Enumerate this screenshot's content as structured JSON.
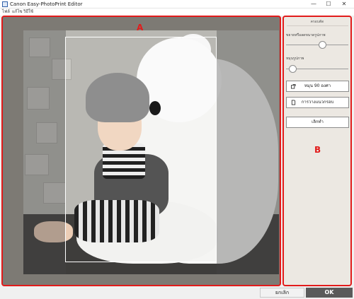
{
  "window": {
    "title": "Canon Easy-PhotoPrint Editor",
    "min_glyph": "—",
    "max_glyph": "☐",
    "close_glyph": "✕"
  },
  "menu": [
    "ไฟล์",
    "แก้ไข",
    "วิธีใช้"
  ],
  "panel_a": {
    "marker": "A"
  },
  "panel_b": {
    "marker": "B",
    "title": "ครอบตัด",
    "sliders": [
      {
        "label": "ขยายหรือลดขนาดรูปภาพ",
        "value": 0.6
      },
      {
        "label": "หมุนรูปภาพ",
        "value": 0.05
      }
    ],
    "buttons": {
      "rotate": "หมุน 90 องศา",
      "orientation": "การวางแนวกรอบ",
      "reset": "เลิกทำ"
    }
  },
  "footer": {
    "cancel": "ยกเลิก",
    "ok": "OK"
  },
  "colors": {
    "accent_red": "#e21b1b",
    "ok_bg": "#5a5a5a"
  }
}
